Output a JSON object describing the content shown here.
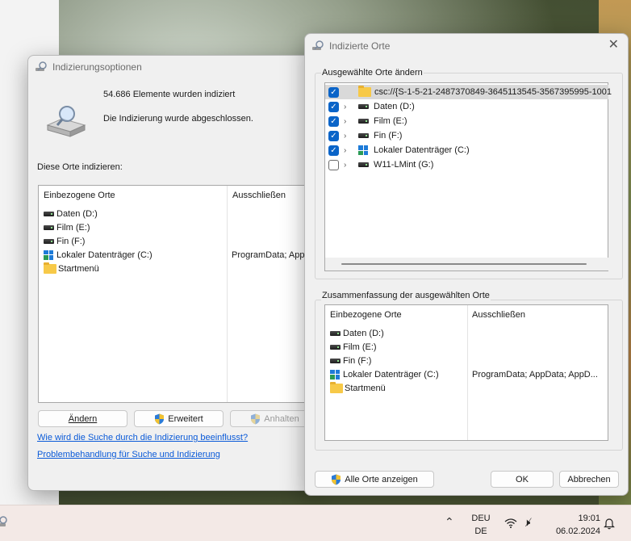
{
  "indexing_options": {
    "title": "Indizierungsoptionen",
    "items_indexed": "54.686 Elemente wurden indiziert",
    "status": "Die Indizierung wurde abgeschlossen.",
    "index_these": "Diese Orte indizieren:",
    "columns": {
      "included": "Einbezogene Orte",
      "exclude": "Ausschließen"
    },
    "rows": [
      {
        "name": "Daten (D:)",
        "icon": "drive-icon",
        "exclude": ""
      },
      {
        "name": "Film (E:)",
        "icon": "drive-icon",
        "exclude": ""
      },
      {
        "name": "Fin (F:)",
        "icon": "drive-icon",
        "exclude": ""
      },
      {
        "name": "Lokaler Datenträger (C:)",
        "icon": "windows-drive-icon",
        "exclude": "ProgramData; AppD"
      },
      {
        "name": "Startmenü",
        "icon": "folder-icon",
        "exclude": ""
      }
    ],
    "buttons": {
      "modify": "Ändern",
      "advanced": "Erweitert",
      "pause": "Anhalten"
    },
    "links": {
      "how_affects": "Wie wird die Suche durch die Indizierung beeinflusst?",
      "troubleshoot": "Problembehandlung für Suche und Indizierung"
    }
  },
  "indexed_locations": {
    "title": "Indizierte Orte",
    "change_group": "Ausgewählte Orte ändern",
    "tree": [
      {
        "label": "csc://{S-1-5-21-2487370849-3645113545-3567395995-1001",
        "checked": true,
        "expandable": false,
        "icon": "folder-icon"
      },
      {
        "label": "Daten (D:)",
        "checked": true,
        "expandable": true,
        "icon": "drive-icon"
      },
      {
        "label": "Film (E:)",
        "checked": true,
        "expandable": true,
        "icon": "drive-icon"
      },
      {
        "label": "Fin (F:)",
        "checked": true,
        "expandable": true,
        "icon": "drive-icon"
      },
      {
        "label": "Lokaler Datenträger (C:)",
        "checked": true,
        "expandable": true,
        "icon": "windows-drive-icon"
      },
      {
        "label": "W11-LMint (G:)",
        "checked": false,
        "expandable": true,
        "icon": "drive-icon"
      }
    ],
    "summary_group": "Zusammenfassung der ausgewählten Orte",
    "columns": {
      "included": "Einbezogene Orte",
      "exclude": "Ausschließen"
    },
    "summary_rows": [
      {
        "name": "Daten (D:)",
        "icon": "drive-icon",
        "exclude": ""
      },
      {
        "name": "Film (E:)",
        "icon": "drive-icon",
        "exclude": ""
      },
      {
        "name": "Fin (F:)",
        "icon": "drive-icon",
        "exclude": ""
      },
      {
        "name": "Lokaler Datenträger (C:)",
        "icon": "windows-drive-icon",
        "exclude": "ProgramData; AppData; AppD..."
      },
      {
        "name": "Startmenü",
        "icon": "folder-icon",
        "exclude": ""
      }
    ],
    "buttons": {
      "show_all": "Alle Orte anzeigen",
      "ok": "OK",
      "cancel": "Abbrechen"
    }
  },
  "taskbar": {
    "lang_top": "DEU",
    "lang_bottom": "DE",
    "time": "19:01",
    "date": "06.02.2024"
  },
  "colors": {
    "accent": "#0a64c8",
    "link": "#0a5ad8"
  }
}
